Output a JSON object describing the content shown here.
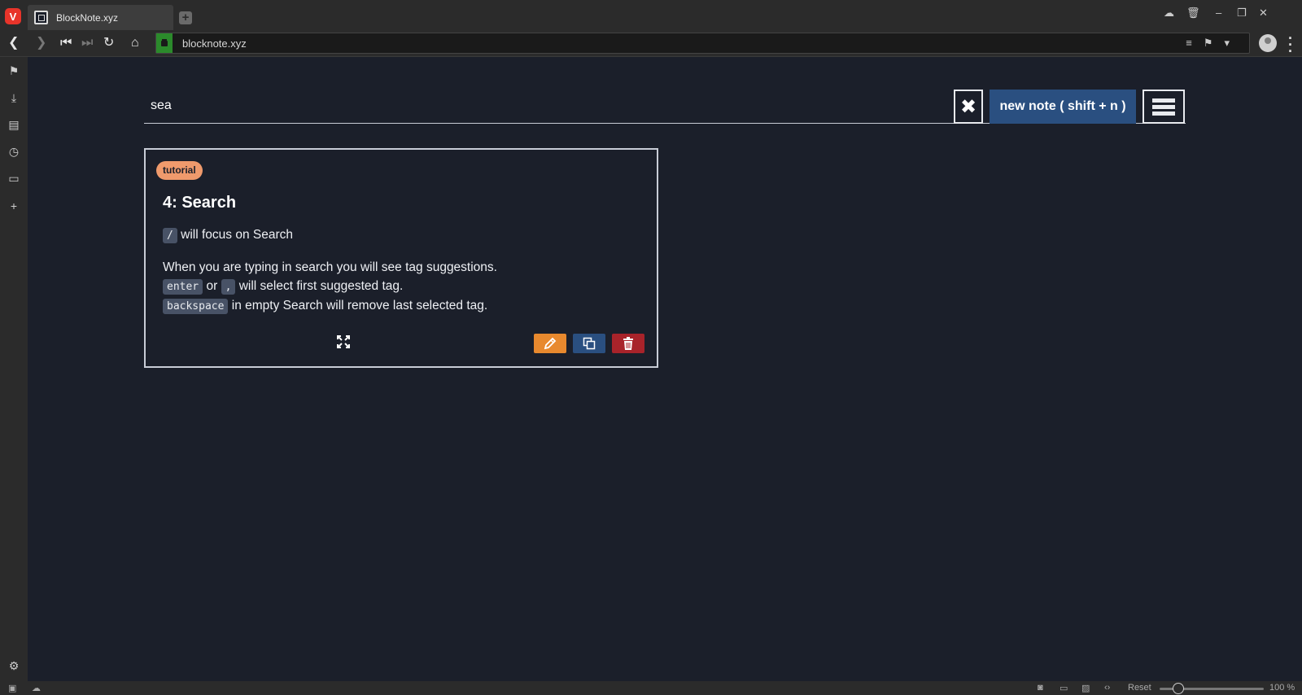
{
  "browser": {
    "tab_title": "BlockNote.xyz",
    "new_tab": "+",
    "url": "blocknote.xyz",
    "logo": "V"
  },
  "statusbar": {
    "reset_label": "Reset",
    "zoom_label": "100 %",
    "zoom_percent": 100
  },
  "app": {
    "search": {
      "value": "sea",
      "placeholder": ""
    },
    "new_note_label": "new note ( shift + n )",
    "note": {
      "tag": "tutorial",
      "title": "4: Search",
      "line1": {
        "key": "/",
        "text": "will focus on Search"
      },
      "line2": "When you are typing in search you will see tag suggestions.",
      "line3": {
        "key1": "enter",
        "or": "or",
        "key2": ",",
        "text": "will select first suggested tag."
      },
      "line4": {
        "key": "backspace",
        "text": "in empty Search will remove last selected tag."
      }
    }
  },
  "colors": {
    "background": "#1b1f2a",
    "primary_button": "#2a4f80",
    "edit_button": "#e8892e",
    "delete_button": "#a8232a",
    "tag": "#ef9a6c",
    "code_bg": "#485266"
  }
}
